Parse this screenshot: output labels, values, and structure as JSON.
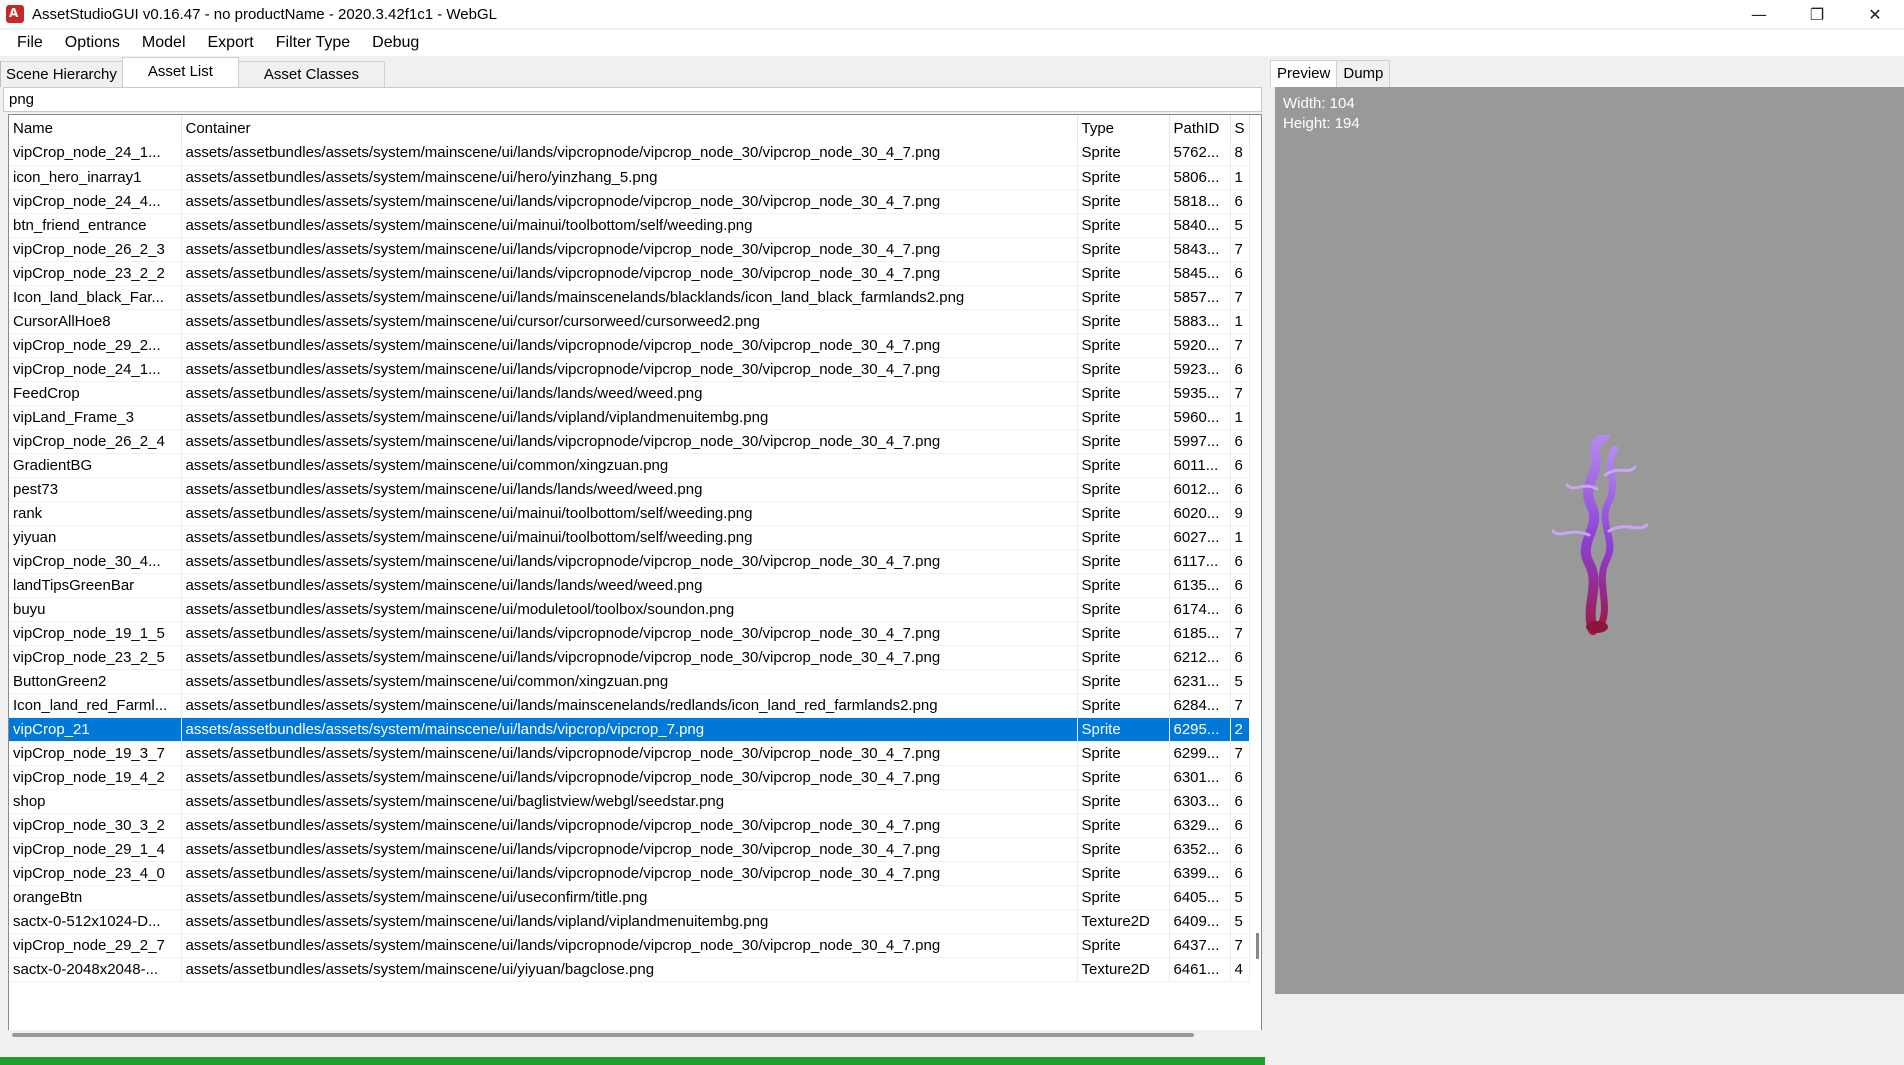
{
  "window": {
    "title": "AssetStudioGUI v0.16.47 - no productName - 2020.3.42f1c1 - WebGL",
    "controls": {
      "minimize": "—",
      "maximize": "❐",
      "close": "✕"
    }
  },
  "menu": [
    "File",
    "Options",
    "Model",
    "Export",
    "Filter Type",
    "Debug"
  ],
  "left_tabs": [
    "Scene Hierarchy",
    "Asset List",
    "Asset Classes"
  ],
  "active_left_tab": "Asset List",
  "filter": {
    "value": "png"
  },
  "table": {
    "columns": [
      "Name",
      "Container",
      "Type",
      "PathID",
      "S"
    ],
    "selected_index": 24,
    "rows": [
      [
        "vipCrop_node_24_1...",
        "assets/assetbundles/assets/system/mainscene/ui/lands/vipcropnode/vipcrop_node_30/vipcrop_node_30_4_7.png",
        "Sprite",
        "5762...",
        "8"
      ],
      [
        "icon_hero_inarray1",
        "assets/assetbundles/assets/system/mainscene/ui/hero/yinzhang_5.png",
        "Sprite",
        "5806...",
        "1"
      ],
      [
        "vipCrop_node_24_4...",
        "assets/assetbundles/assets/system/mainscene/ui/lands/vipcropnode/vipcrop_node_30/vipcrop_node_30_4_7.png",
        "Sprite",
        "5818...",
        "6"
      ],
      [
        "btn_friend_entrance",
        "assets/assetbundles/assets/system/mainscene/ui/mainui/toolbottom/self/weeding.png",
        "Sprite",
        "5840...",
        "5"
      ],
      [
        "vipCrop_node_26_2_3",
        "assets/assetbundles/assets/system/mainscene/ui/lands/vipcropnode/vipcrop_node_30/vipcrop_node_30_4_7.png",
        "Sprite",
        "5843...",
        "7"
      ],
      [
        "vipCrop_node_23_2_2",
        "assets/assetbundles/assets/system/mainscene/ui/lands/vipcropnode/vipcrop_node_30/vipcrop_node_30_4_7.png",
        "Sprite",
        "5845...",
        "6"
      ],
      [
        "Icon_land_black_Far...",
        "assets/assetbundles/assets/system/mainscene/ui/lands/mainscenelands/blacklands/icon_land_black_farmlands2.png",
        "Sprite",
        "5857...",
        "7"
      ],
      [
        "CursorAllHoe8",
        "assets/assetbundles/assets/system/mainscene/ui/cursor/cursorweed/cursorweed2.png",
        "Sprite",
        "5883...",
        "1"
      ],
      [
        "vipCrop_node_29_2...",
        "assets/assetbundles/assets/system/mainscene/ui/lands/vipcropnode/vipcrop_node_30/vipcrop_node_30_4_7.png",
        "Sprite",
        "5920...",
        "7"
      ],
      [
        "vipCrop_node_24_1...",
        "assets/assetbundles/assets/system/mainscene/ui/lands/vipcropnode/vipcrop_node_30/vipcrop_node_30_4_7.png",
        "Sprite",
        "5923...",
        "6"
      ],
      [
        "FeedCrop",
        "assets/assetbundles/assets/system/mainscene/ui/lands/lands/weed/weed.png",
        "Sprite",
        "5935...",
        "7"
      ],
      [
        "vipLand_Frame_3",
        "assets/assetbundles/assets/system/mainscene/ui/lands/vipland/viplandmenuitembg.png",
        "Sprite",
        "5960...",
        "1"
      ],
      [
        "vipCrop_node_26_2_4",
        "assets/assetbundles/assets/system/mainscene/ui/lands/vipcropnode/vipcrop_node_30/vipcrop_node_30_4_7.png",
        "Sprite",
        "5997...",
        "6"
      ],
      [
        "GradientBG",
        "assets/assetbundles/assets/system/mainscene/ui/common/xingzuan.png",
        "Sprite",
        "6011...",
        "6"
      ],
      [
        "pest73",
        "assets/assetbundles/assets/system/mainscene/ui/lands/lands/weed/weed.png",
        "Sprite",
        "6012...",
        "6"
      ],
      [
        "rank",
        "assets/assetbundles/assets/system/mainscene/ui/mainui/toolbottom/self/weeding.png",
        "Sprite",
        "6020...",
        "9"
      ],
      [
        "yiyuan",
        "assets/assetbundles/assets/system/mainscene/ui/mainui/toolbottom/self/weeding.png",
        "Sprite",
        "6027...",
        "1"
      ],
      [
        "vipCrop_node_30_4...",
        "assets/assetbundles/assets/system/mainscene/ui/lands/vipcropnode/vipcrop_node_30/vipcrop_node_30_4_7.png",
        "Sprite",
        "6117...",
        "6"
      ],
      [
        "landTipsGreenBar",
        "assets/assetbundles/assets/system/mainscene/ui/lands/lands/weed/weed.png",
        "Sprite",
        "6135...",
        "6"
      ],
      [
        "buyu",
        "assets/assetbundles/assets/system/mainscene/ui/moduletool/toolbox/soundon.png",
        "Sprite",
        "6174...",
        "6"
      ],
      [
        "vipCrop_node_19_1_5",
        "assets/assetbundles/assets/system/mainscene/ui/lands/vipcropnode/vipcrop_node_30/vipcrop_node_30_4_7.png",
        "Sprite",
        "6185...",
        "7"
      ],
      [
        "vipCrop_node_23_2_5",
        "assets/assetbundles/assets/system/mainscene/ui/lands/vipcropnode/vipcrop_node_30/vipcrop_node_30_4_7.png",
        "Sprite",
        "6212...",
        "6"
      ],
      [
        "ButtonGreen2",
        "assets/assetbundles/assets/system/mainscene/ui/common/xingzuan.png",
        "Sprite",
        "6231...",
        "5"
      ],
      [
        "Icon_land_red_Farml...",
        "assets/assetbundles/assets/system/mainscene/ui/lands/mainscenelands/redlands/icon_land_red_farmlands2.png",
        "Sprite",
        "6284...",
        "7"
      ],
      [
        "vipCrop_21",
        "assets/assetbundles/assets/system/mainscene/ui/lands/vipcrop/vipcrop_7.png",
        "Sprite",
        "6295...",
        "2"
      ],
      [
        "vipCrop_node_19_3_7",
        "assets/assetbundles/assets/system/mainscene/ui/lands/vipcropnode/vipcrop_node_30/vipcrop_node_30_4_7.png",
        "Sprite",
        "6299...",
        "7"
      ],
      [
        "vipCrop_node_19_4_2",
        "assets/assetbundles/assets/system/mainscene/ui/lands/vipcropnode/vipcrop_node_30/vipcrop_node_30_4_7.png",
        "Sprite",
        "6301...",
        "6"
      ],
      [
        "shop",
        "assets/assetbundles/assets/system/mainscene/ui/baglistview/webgl/seedstar.png",
        "Sprite",
        "6303...",
        "6"
      ],
      [
        "vipCrop_node_30_3_2",
        "assets/assetbundles/assets/system/mainscene/ui/lands/vipcropnode/vipcrop_node_30/vipcrop_node_30_4_7.png",
        "Sprite",
        "6329...",
        "6"
      ],
      [
        "vipCrop_node_29_1_4",
        "assets/assetbundles/assets/system/mainscene/ui/lands/vipcropnode/vipcrop_node_30/vipcrop_node_30_4_7.png",
        "Sprite",
        "6352...",
        "6"
      ],
      [
        "vipCrop_node_23_4_0",
        "assets/assetbundles/assets/system/mainscene/ui/lands/vipcropnode/vipcrop_node_30/vipcrop_node_30_4_7.png",
        "Sprite",
        "6399...",
        "6"
      ],
      [
        "orangeBtn",
        "assets/assetbundles/assets/system/mainscene/ui/useconfirm/title.png",
        "Sprite",
        "6405...",
        "5"
      ],
      [
        "sactx-0-512x1024-D...",
        "assets/assetbundles/assets/system/mainscene/ui/lands/vipland/viplandmenuitembg.png",
        "Texture2D",
        "6409...",
        "5"
      ],
      [
        "vipCrop_node_29_2_7",
        "assets/assetbundles/assets/system/mainscene/ui/lands/vipcropnode/vipcrop_node_30/vipcrop_node_30_4_7.png",
        "Sprite",
        "6437...",
        "7"
      ],
      [
        "sactx-0-2048x2048-...",
        "assets/assetbundles/assets/system/mainscene/ui/yiyuan/bagclose.png",
        "Texture2D",
        "6461...",
        "4"
      ]
    ]
  },
  "right_tabs": [
    "Preview",
    "Dump"
  ],
  "active_right_tab": "Preview",
  "preview": {
    "width_label": "Width: 104",
    "height_label": "Height: 194",
    "background": "#999999"
  },
  "colors": {
    "selection": "#0078d7",
    "progress": "#1f9c2a",
    "app_icon": "#c62828"
  }
}
